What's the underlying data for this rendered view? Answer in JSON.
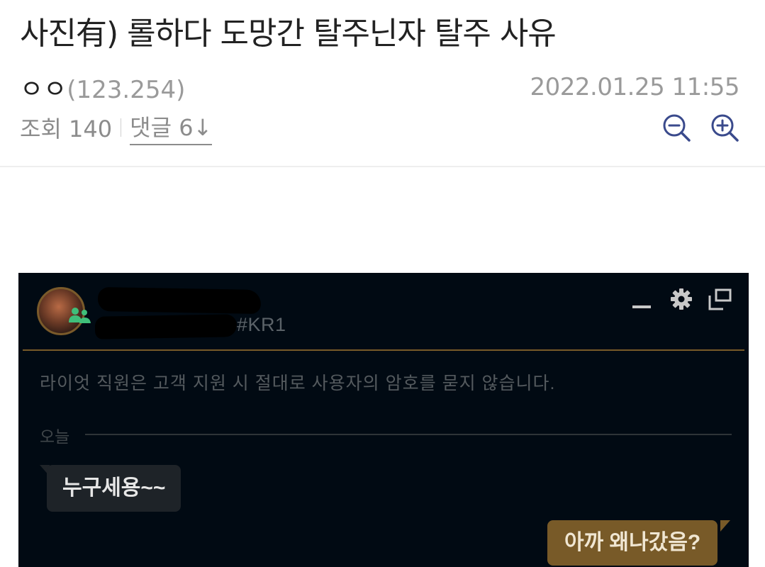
{
  "post": {
    "title": "사진有) 롤하다 도망간 탈주닌자 탈주 사유",
    "author": "ㅇㅇ",
    "author_ip": "(123.254)",
    "date": "2022.01.25 11:55",
    "views_label": "조회 140",
    "comments_label": "댓글 6↓"
  },
  "icons": {
    "zoom_out": "zoom-out-icon",
    "zoom_in": "zoom-in-icon"
  },
  "screenshot": {
    "tag": "#KR1",
    "notice": "라이엇 직원은 고객 지원 시 절대로 사용자의 암호를 묻지 않습니다.",
    "day_label": "오늘",
    "messages": [
      {
        "direction": "incoming",
        "text": "누구세용~~"
      },
      {
        "direction": "outgoing",
        "text": "아까 왜나갔음?"
      }
    ],
    "colors": {
      "background": "#010a13",
      "gold": "#785a28",
      "incoming_bubble": "#1e2328",
      "online": "#3fbf7a"
    }
  }
}
